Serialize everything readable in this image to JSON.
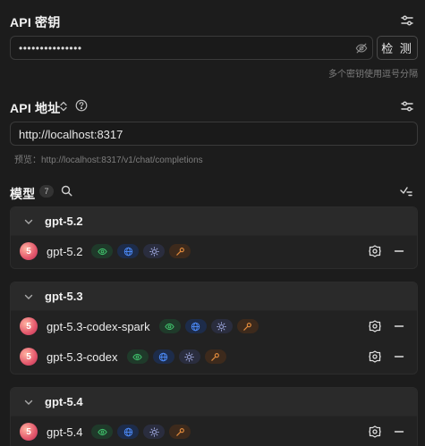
{
  "api_key": {
    "title": "API 密钥",
    "value": "•••••••••••••••",
    "detect_label": "检 测",
    "hint": "多个密钥使用逗号分隔"
  },
  "api_address": {
    "title": "API 地址",
    "value": "http://localhost:8317",
    "preview": "预览：http://localhost:8317/v1/chat/completions"
  },
  "models": {
    "title": "模型",
    "count": "7",
    "groups": [
      {
        "name": "gpt-5.2",
        "items": [
          {
            "avatar": "5",
            "name": "gpt-5.2"
          }
        ]
      },
      {
        "name": "gpt-5.3",
        "items": [
          {
            "avatar": "5",
            "name": "gpt-5.3-codex-spark"
          },
          {
            "avatar": "5",
            "name": "gpt-5.3-codex"
          }
        ]
      },
      {
        "name": "gpt-5.4",
        "items": [
          {
            "avatar": "5",
            "name": "gpt-5.4"
          }
        ]
      }
    ]
  },
  "colors": {
    "vision": "#3fbf6a",
    "web": "#4a86f0",
    "reasoning": "#9aa3d8",
    "tool": "#e08a3c"
  },
  "icons": [
    "settings-sliders-icon",
    "eye-off-icon",
    "chevron-updown-icon",
    "help-circle-icon",
    "search-icon",
    "check-sort-icon",
    "chevron-down-icon",
    "eye-icon",
    "globe-icon",
    "lightbulb-icon",
    "wrench-icon",
    "gear-icon",
    "minus-icon"
  ]
}
